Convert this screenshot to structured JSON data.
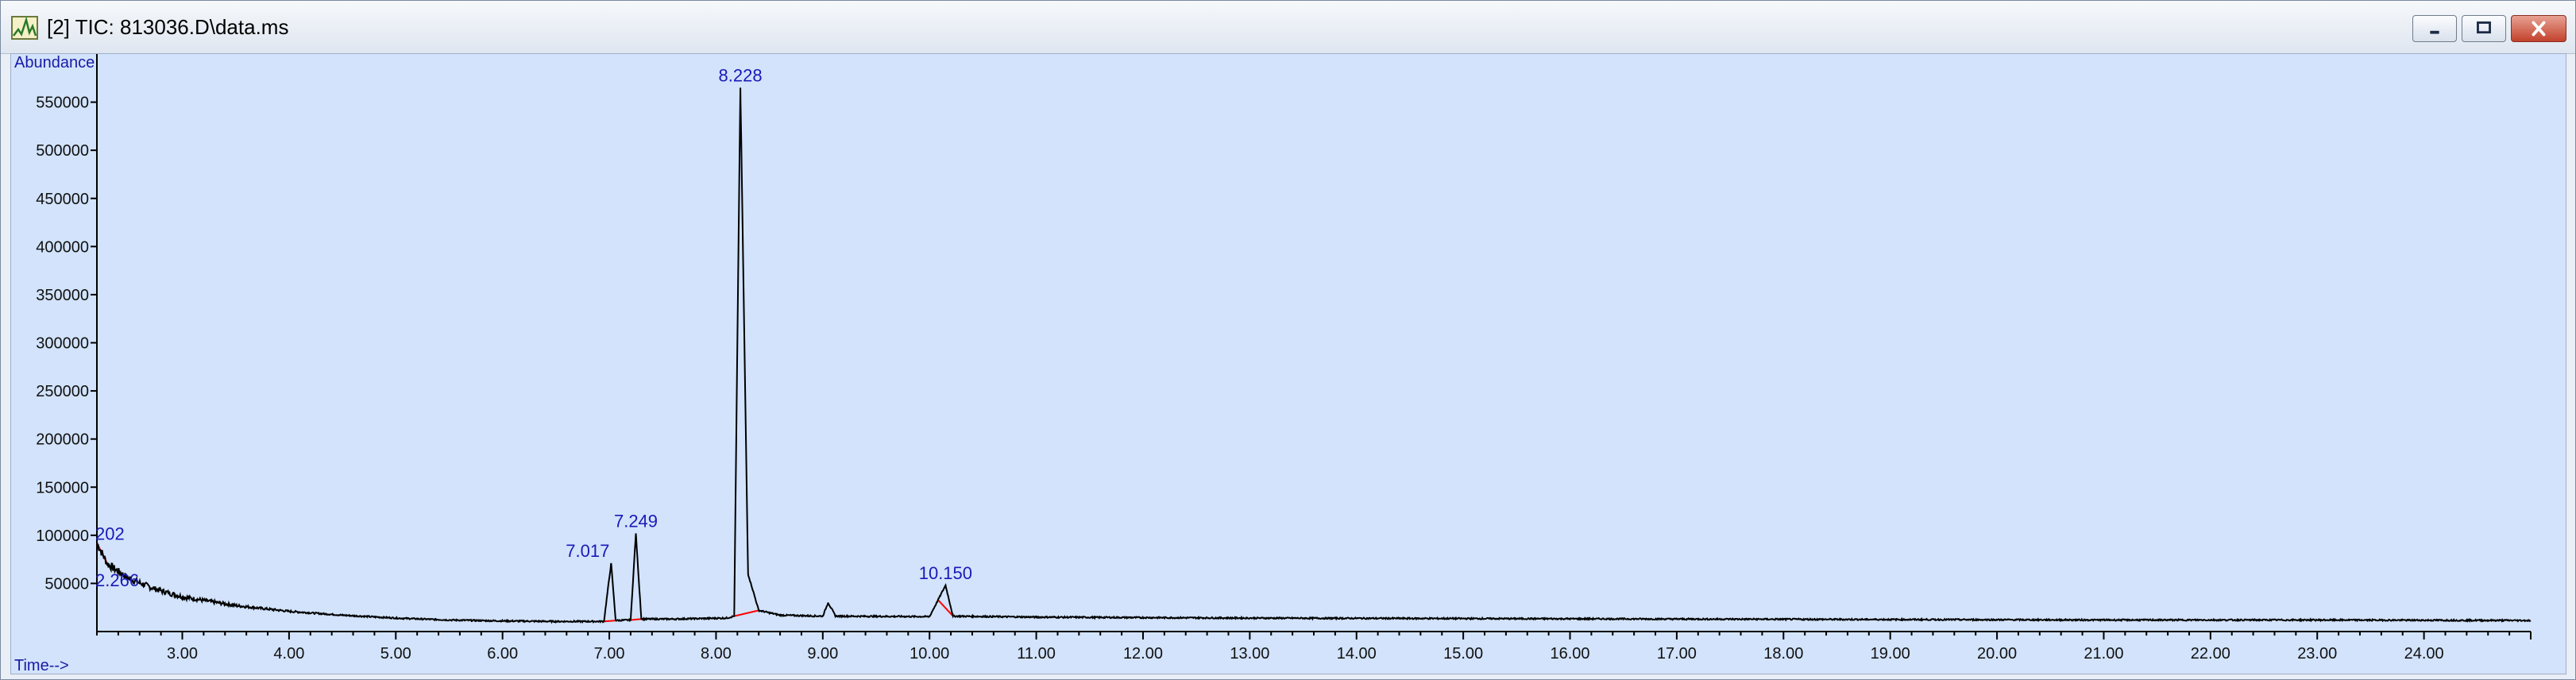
{
  "window": {
    "title": "[2] TIC: 813036.D\\data.ms",
    "icon": "chromatogram-app-icon",
    "buttons": [
      "minimize-icon",
      "restore-icon",
      "close-icon"
    ],
    "colors": {
      "plot_bg": "#d2e3fb",
      "trace": "#000000",
      "baseline": "#ff0000",
      "labels": "#1a1ab8"
    }
  },
  "chart_data": {
    "type": "line",
    "ylabel": "Abundance",
    "xlabel": "Time-->",
    "xlim": [
      2.2,
      25.0
    ],
    "ylim": [
      0,
      600000
    ],
    "x_ticks": [
      "3.00",
      "4.00",
      "5.00",
      "6.00",
      "7.00",
      "8.00",
      "9.00",
      "10.00",
      "11.00",
      "12.00",
      "13.00",
      "14.00",
      "15.00",
      "16.00",
      "17.00",
      "18.00",
      "19.00",
      "20.00",
      "21.00",
      "22.00",
      "23.00",
      "24.00"
    ],
    "y_ticks": [
      "50000",
      "100000",
      "150000",
      "200000",
      "250000",
      "300000",
      "350000",
      "400000",
      "450000",
      "500000",
      "550000"
    ],
    "grid": false,
    "series": [
      {
        "points": [
          [
            2.2,
            92000
          ],
          [
            2.3,
            70000
          ],
          [
            2.5,
            55000
          ],
          [
            2.75,
            44000
          ],
          [
            3.0,
            36000
          ],
          [
            3.5,
            27000
          ],
          [
            4.0,
            21000
          ],
          [
            4.5,
            17000
          ],
          [
            5.0,
            14000
          ],
          [
            5.5,
            12000
          ],
          [
            6.0,
            11000
          ],
          [
            6.5,
            10500
          ],
          [
            6.95,
            10500
          ],
          [
            7.017,
            71000
          ],
          [
            7.06,
            11500
          ],
          [
            7.2,
            12000
          ],
          [
            7.249,
            102000
          ],
          [
            7.3,
            13000
          ],
          [
            7.6,
            13000
          ],
          [
            8.1,
            14000
          ],
          [
            8.17,
            16000
          ],
          [
            8.228,
            565000
          ],
          [
            8.26,
            340000
          ],
          [
            8.3,
            60000
          ],
          [
            8.4,
            22000
          ],
          [
            8.6,
            17000
          ],
          [
            9.0,
            16000
          ],
          [
            9.05,
            30000
          ],
          [
            9.12,
            16000
          ],
          [
            10.0,
            15500
          ],
          [
            10.15,
            48000
          ],
          [
            10.22,
            16000
          ],
          [
            11.0,
            15000
          ],
          [
            13.0,
            14000
          ],
          [
            15.0,
            13500
          ],
          [
            17.0,
            13000
          ],
          [
            19.0,
            12500
          ],
          [
            21.0,
            12000
          ],
          [
            23.0,
            12000
          ],
          [
            25.0,
            11500
          ]
        ]
      }
    ],
    "annotations": [
      {
        "label": "202",
        "x": 2.202,
        "y": 92000
      },
      {
        "label": "2.266",
        "x": 2.266,
        "y": 70000
      },
      {
        "label": "7.017",
        "x": 7.017,
        "y": 71000
      },
      {
        "label": "7.249",
        "x": 7.249,
        "y": 102000
      },
      {
        "label": "8.228",
        "x": 8.228,
        "y": 565000
      },
      {
        "label": "10.150",
        "x": 10.15,
        "y": 48000
      }
    ]
  }
}
